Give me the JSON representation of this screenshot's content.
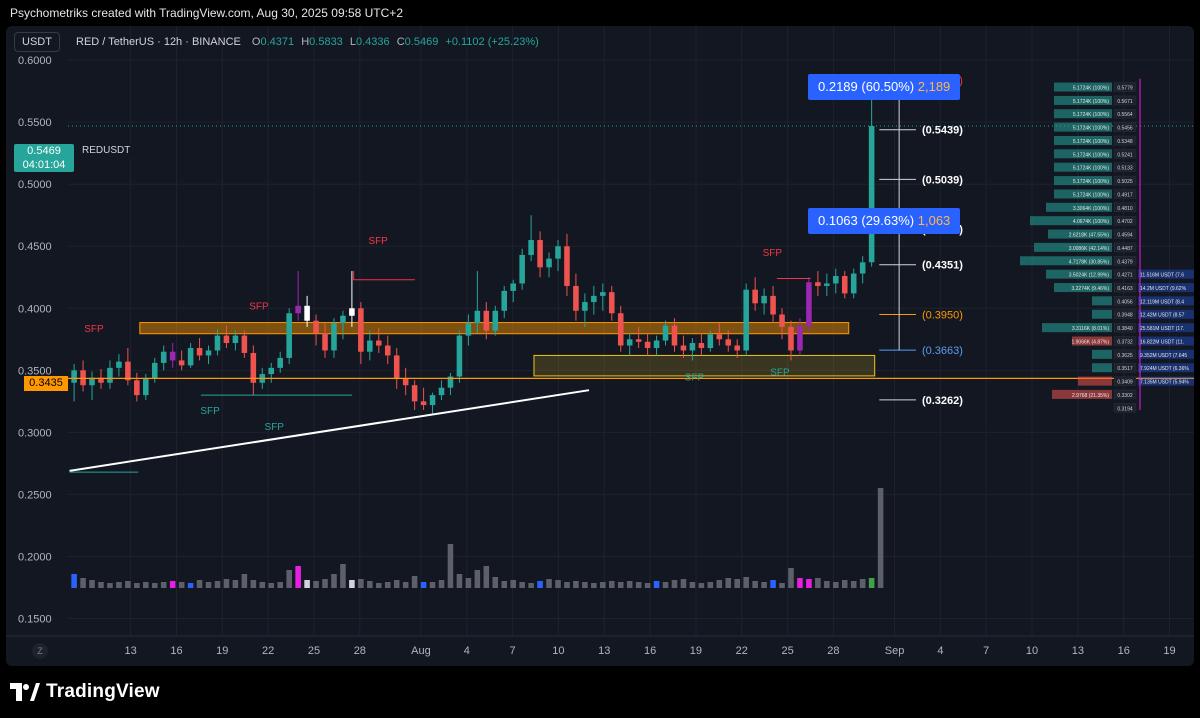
{
  "header": {
    "attribution": "Psychometriks created with TradingView.com, Aug 30, 2025 09:58 UTC+2"
  },
  "toolbar": {
    "symbol_button": "USDT",
    "pair": "RED / TetherUS · 12h · BINANCE",
    "open_label": "O",
    "open": "0.4371",
    "high_label": "H",
    "high": "0.5833",
    "low_label": "L",
    "low": "0.4336",
    "close_label": "C",
    "close": "0.5469",
    "change": "+0.1102 (+25.23%)"
  },
  "price_tag": {
    "value": "0.5469",
    "countdown": "04:01:04",
    "symbol": "REDUSDT"
  },
  "level_tag": "0.3435",
  "z_button": "Z",
  "measure_boxes": [
    {
      "name": "measure-top",
      "text_a": "0.2189 (60.50%)",
      "text_b": "2,189"
    },
    {
      "name": "measure-mid",
      "text_a": "0.1063 (29.63%)",
      "text_b": "1,063"
    }
  ],
  "footer": {
    "logo": "TradingView"
  },
  "colors": {
    "background": "#131722",
    "up": "#26a69a",
    "down": "#ef5350",
    "purple": "#9c27b0",
    "orange": "#ff9800",
    "yellow_zone": "#f0c419",
    "label_red": "#f23645",
    "label_blue": "#2962ff"
  },
  "chart_data": {
    "type": "candlestick",
    "symbol": "REDUSDT",
    "interval": "12h",
    "exchange": "BINANCE",
    "y_axis": {
      "ticks": [
        0.15,
        0.2,
        0.25,
        0.3,
        0.35,
        0.4,
        0.45,
        0.5,
        0.55,
        0.6
      ],
      "tick_labels": [
        "0.1500",
        "0.2000",
        "0.2500",
        "0.3000",
        "0.3500",
        "0.4000",
        "0.4500",
        "0.5000",
        "0.5500",
        "0.6000"
      ],
      "range": [
        0.1375,
        0.6275
      ]
    },
    "x_axis": {
      "ticks": [
        {
          "label": "13",
          "day": 13
        },
        {
          "label": "16",
          "day": 16
        },
        {
          "label": "19",
          "day": 19
        },
        {
          "label": "22",
          "day": 22
        },
        {
          "label": "25",
          "day": 25
        },
        {
          "label": "28",
          "day": 28
        },
        {
          "label": "Aug",
          "day": 32
        },
        {
          "label": "4",
          "day": 35
        },
        {
          "label": "7",
          "day": 38
        },
        {
          "label": "10",
          "day": 41
        },
        {
          "label": "13",
          "day": 44
        },
        {
          "label": "16",
          "day": 47
        },
        {
          "label": "19",
          "day": 50
        },
        {
          "label": "22",
          "day": 53
        },
        {
          "label": "25",
          "day": 56
        },
        {
          "label": "28",
          "day": 59
        },
        {
          "label": "Sep",
          "day": 63
        },
        {
          "label": "4",
          "day": 66
        },
        {
          "label": "7",
          "day": 69
        },
        {
          "label": "10",
          "day": 72
        },
        {
          "label": "13",
          "day": 75
        },
        {
          "label": "16",
          "day": 78
        },
        {
          "label": "19",
          "day": 81
        }
      ],
      "range": [
        8.9,
        82.6
      ]
    },
    "candles": [
      [
        0.34,
        0.355,
        0.325,
        0.35
      ],
      [
        0.35,
        0.358,
        0.333,
        0.338
      ],
      [
        0.338,
        0.349,
        0.326,
        0.344
      ],
      [
        0.344,
        0.351,
        0.335,
        0.34
      ],
      [
        0.34,
        0.358,
        0.335,
        0.352
      ],
      [
        0.352,
        0.363,
        0.345,
        0.357
      ],
      [
        0.357,
        0.368,
        0.338,
        0.342
      ],
      [
        0.342,
        0.348,
        0.325,
        0.33
      ],
      [
        0.33,
        0.347,
        0.326,
        0.343
      ],
      [
        0.343,
        0.36,
        0.34,
        0.356
      ],
      [
        0.356,
        0.37,
        0.35,
        0.365
      ],
      [
        0.365,
        0.372,
        0.352,
        0.358
      ],
      [
        0.358,
        0.366,
        0.35,
        0.354
      ],
      [
        0.354,
        0.372,
        0.352,
        0.368
      ],
      [
        0.368,
        0.376,
        0.358,
        0.362
      ],
      [
        0.362,
        0.37,
        0.355,
        0.366
      ],
      [
        0.366,
        0.383,
        0.362,
        0.378
      ],
      [
        0.378,
        0.386,
        0.368,
        0.372
      ],
      [
        0.372,
        0.382,
        0.366,
        0.378
      ],
      [
        0.378,
        0.382,
        0.36,
        0.364
      ],
      [
        0.364,
        0.37,
        0.33,
        0.34
      ],
      [
        0.34,
        0.352,
        0.335,
        0.347
      ],
      [
        0.347,
        0.356,
        0.34,
        0.352
      ],
      [
        0.352,
        0.365,
        0.348,
        0.36
      ],
      [
        0.36,
        0.4,
        0.355,
        0.396
      ],
      [
        0.396,
        0.43,
        0.39,
        0.402
      ],
      [
        0.402,
        0.41,
        0.385,
        0.39
      ],
      [
        0.39,
        0.395,
        0.37,
        0.38
      ],
      [
        0.38,
        0.388,
        0.36,
        0.366
      ],
      [
        0.366,
        0.392,
        0.36,
        0.388
      ],
      [
        0.388,
        0.398,
        0.375,
        0.394
      ],
      [
        0.394,
        0.43,
        0.385,
        0.4
      ],
      [
        0.4,
        0.405,
        0.355,
        0.365
      ],
      [
        0.365,
        0.382,
        0.358,
        0.374
      ],
      [
        0.374,
        0.384,
        0.364,
        0.37
      ],
      [
        0.37,
        0.378,
        0.355,
        0.362
      ],
      [
        0.362,
        0.368,
        0.335,
        0.343
      ],
      [
        0.343,
        0.352,
        0.33,
        0.338
      ],
      [
        0.338,
        0.342,
        0.318,
        0.325
      ],
      [
        0.325,
        0.336,
        0.318,
        0.322
      ],
      [
        0.322,
        0.332,
        0.315,
        0.33
      ],
      [
        0.33,
        0.342,
        0.326,
        0.336
      ],
      [
        0.336,
        0.348,
        0.33,
        0.345
      ],
      [
        0.345,
        0.382,
        0.34,
        0.378
      ],
      [
        0.378,
        0.395,
        0.37,
        0.388
      ],
      [
        0.388,
        0.43,
        0.38,
        0.398
      ],
      [
        0.398,
        0.405,
        0.375,
        0.382
      ],
      [
        0.382,
        0.402,
        0.378,
        0.398
      ],
      [
        0.398,
        0.418,
        0.392,
        0.414
      ],
      [
        0.414,
        0.423,
        0.405,
        0.42
      ],
      [
        0.42,
        0.448,
        0.415,
        0.443
      ],
      [
        0.443,
        0.475,
        0.438,
        0.455
      ],
      [
        0.455,
        0.462,
        0.425,
        0.433
      ],
      [
        0.433,
        0.445,
        0.425,
        0.44
      ],
      [
        0.44,
        0.455,
        0.43,
        0.45
      ],
      [
        0.45,
        0.46,
        0.41,
        0.418
      ],
      [
        0.418,
        0.428,
        0.39,
        0.398
      ],
      [
        0.398,
        0.412,
        0.385,
        0.405
      ],
      [
        0.405,
        0.418,
        0.395,
        0.41
      ],
      [
        0.41,
        0.42,
        0.398,
        0.413
      ],
      [
        0.413,
        0.418,
        0.39,
        0.396
      ],
      [
        0.396,
        0.402,
        0.365,
        0.37
      ],
      [
        0.37,
        0.38,
        0.362,
        0.375
      ],
      [
        0.375,
        0.385,
        0.368,
        0.373
      ],
      [
        0.373,
        0.38,
        0.362,
        0.368
      ],
      [
        0.368,
        0.378,
        0.362,
        0.374
      ],
      [
        0.374,
        0.39,
        0.37,
        0.386
      ],
      [
        0.386,
        0.392,
        0.365,
        0.37
      ],
      [
        0.37,
        0.378,
        0.36,
        0.366
      ],
      [
        0.366,
        0.376,
        0.358,
        0.372
      ],
      [
        0.372,
        0.38,
        0.362,
        0.368
      ],
      [
        0.368,
        0.382,
        0.365,
        0.379
      ],
      [
        0.379,
        0.388,
        0.37,
        0.375
      ],
      [
        0.375,
        0.382,
        0.365,
        0.37
      ],
      [
        0.37,
        0.375,
        0.36,
        0.366
      ],
      [
        0.366,
        0.42,
        0.362,
        0.415
      ],
      [
        0.415,
        0.425,
        0.398,
        0.404
      ],
      [
        0.404,
        0.416,
        0.395,
        0.41
      ],
      [
        0.41,
        0.418,
        0.388,
        0.395
      ],
      [
        0.395,
        0.4,
        0.375,
        0.385
      ],
      [
        0.385,
        0.39,
        0.358,
        0.366
      ],
      [
        0.366,
        0.392,
        0.362,
        0.386
      ],
      [
        0.386,
        0.425,
        0.38,
        0.421
      ],
      [
        0.421,
        0.43,
        0.41,
        0.418
      ],
      [
        0.418,
        0.428,
        0.41,
        0.42
      ],
      [
        0.42,
        0.432,
        0.412,
        0.426
      ],
      [
        0.426,
        0.43,
        0.408,
        0.412
      ],
      [
        0.412,
        0.432,
        0.408,
        0.428
      ],
      [
        0.428,
        0.442,
        0.42,
        0.437
      ],
      [
        0.4371,
        0.5833,
        0.4336,
        0.5469
      ]
    ],
    "candle_colors": {
      "26": "white",
      "31": "white",
      "25": "purple",
      "82": "purple",
      "81": "purple",
      "11": "purple"
    },
    "volume": {
      "ylim": [
        0,
        100
      ],
      "values": [
        14,
        10,
        8,
        6,
        5,
        6,
        7,
        5,
        6,
        5,
        6,
        7,
        6,
        5,
        8,
        6,
        7,
        9,
        8,
        14,
        8,
        6,
        5,
        6,
        18,
        22,
        8,
        7,
        9,
        14,
        24,
        8,
        9,
        7,
        5,
        6,
        8,
        6,
        12,
        6,
        6,
        8,
        44,
        14,
        10,
        18,
        22,
        11,
        7,
        8,
        6,
        5,
        7,
        9,
        8,
        6,
        7,
        6,
        5,
        6,
        7,
        6,
        7,
        6,
        5,
        7,
        6,
        8,
        9,
        6,
        5,
        6,
        8,
        10,
        9,
        11,
        7,
        6,
        8,
        5,
        20,
        10,
        9,
        10,
        7,
        6,
        8,
        7,
        9,
        10,
        100
      ]
    },
    "annotations": {
      "price_labels": [
        {
          "text": "(0.5839)",
          "price": 0.5839,
          "color": "#f23645"
        },
        {
          "text": "(0.5439)",
          "price": 0.5439,
          "color": "#ffffff"
        },
        {
          "text": "(0.5039)",
          "price": 0.5039,
          "color": "#ffffff"
        },
        {
          "text": "(0.4638)",
          "price": 0.4638,
          "color": "#ffffff"
        },
        {
          "text": "(0.4351)",
          "price": 0.4351,
          "color": "#ffffff"
        },
        {
          "text": "(0.3950)",
          "price": 0.395,
          "color": "#ff9800"
        },
        {
          "text": "(0.3663)",
          "price": 0.3663,
          "color": "#5b9cf6"
        },
        {
          "text": "(0.3262)",
          "price": 0.3262,
          "color": "#ffffff"
        }
      ],
      "sfp_labels": [
        {
          "text": "SFP",
          "day": 10.6,
          "price": 0.381,
          "color": "#f23645"
        },
        {
          "text": "SFP",
          "day": 21.4,
          "price": 0.399,
          "color": "#f23645"
        },
        {
          "text": "SFP",
          "day": 29.2,
          "price": 0.452,
          "color": "#f23645"
        },
        {
          "text": "SFP",
          "day": 55.0,
          "price": 0.442,
          "color": "#f23645"
        },
        {
          "text": "SFP",
          "day": 18.2,
          "price": 0.315,
          "color": "#26a69a"
        },
        {
          "text": "SFP",
          "day": 22.4,
          "price": 0.302,
          "color": "#26a69a"
        },
        {
          "text": "SFP",
          "day": 49.9,
          "price": 0.342,
          "color": "#26a69a"
        },
        {
          "text": "SFP",
          "day": 55.5,
          "price": 0.346,
          "color": "#26a69a"
        }
      ],
      "orange_level": 0.3435,
      "last_price": 0.5469
    },
    "order_book": {
      "rows": [
        {
          "price_label": "0.5779",
          "size_label": "5.1724K (100%)",
          "width": 58,
          "color": "teal"
        },
        {
          "price_label": "0.5671",
          "size_label": "5.1724K (100%)",
          "width": 58,
          "color": "teal"
        },
        {
          "price_label": "0.5564",
          "size_label": "5.1724K (100%)",
          "width": 58,
          "color": "teal"
        },
        {
          "price_label": "0.5456",
          "size_label": "5.1724K (100%)",
          "width": 58,
          "color": "teal"
        },
        {
          "price_label": "0.5348",
          "size_label": "5.1724K (100%)",
          "width": 58,
          "color": "teal"
        },
        {
          "price_label": "0.5241",
          "size_label": "5.1724K (100%)",
          "width": 58,
          "color": "teal"
        },
        {
          "price_label": "0.5133",
          "size_label": "5.1724K (100%)",
          "width": 58,
          "color": "teal"
        },
        {
          "price_label": "0.5025",
          "size_label": "5.1724K (100%)",
          "width": 58,
          "color": "teal"
        },
        {
          "price_label": "0.4917",
          "size_label": "5.1724K (100%)",
          "width": 58,
          "color": "teal"
        },
        {
          "price_label": "0.4810",
          "size_label": "3.3064K (100%)",
          "width": 66,
          "color": "teal"
        },
        {
          "price_label": "0.4702",
          "size_label": "4.0674K (100%)",
          "width": 82,
          "color": "teal"
        },
        {
          "price_label": "0.4594",
          "size_label": "2.6218K (47.55%)",
          "width": 64,
          "color": "teal"
        },
        {
          "price_label": "0.4487",
          "size_label": "3.0086K (42.14%)",
          "width": 78,
          "color": "teal"
        },
        {
          "price_label": "0.4379",
          "size_label": "4.7178K (30.85%)",
          "width": 92,
          "color": "teal"
        },
        {
          "price_label": "0.4271",
          "size_label": "3.5024K (12.99%)",
          "width": 66,
          "color": "teal"
        },
        {
          "price_label": "0.4163",
          "size_label": "3.2274K (9.46%)",
          "width": 58,
          "color": "teal"
        },
        {
          "price_label": "0.4056",
          "size_label": "",
          "width": 20,
          "color": "teal"
        },
        {
          "price_label": "0.3948",
          "size_label": "",
          "width": 20,
          "color": "teal"
        },
        {
          "price_label": "0.3840",
          "size_label": "3.3116K (8.01%)",
          "width": 70,
          "color": "teal"
        },
        {
          "price_label": "0.3732",
          "size_label": "1.9066K (4.87%)",
          "width": 40,
          "color": "red"
        },
        {
          "price_label": "0.3625",
          "size_label": "",
          "width": 20,
          "color": "teal"
        },
        {
          "price_label": "0.3517",
          "size_label": "",
          "width": 20,
          "color": "teal"
        },
        {
          "price_label": "0.3409",
          "size_label": "",
          "width": 34,
          "color": "red"
        },
        {
          "price_label": "0.3302",
          "size_label": "2.9768 (21.35%)",
          "width": 60,
          "color": "red"
        },
        {
          "price_label": "0.3194",
          "size_label": "",
          "width": 0,
          "color": "red"
        }
      ],
      "right_labels": [
        {
          "price": 0.4271,
          "text": "11.516M USDT (7.6"
        },
        {
          "price": 0.4163,
          "text": "14.2M USDT (9.62%"
        },
        {
          "price": 0.4056,
          "text": "12.119M USDT (8.4"
        },
        {
          "price": 0.3948,
          "text": "12.42M USDT (8.57"
        },
        {
          "price": 0.384,
          "text": "25.581M USDT (17."
        },
        {
          "price": 0.3732,
          "text": "16.822M USDT (11."
        },
        {
          "price": 0.3625,
          "text": "9.352M USDT (7.645"
        },
        {
          "price": 0.3517,
          "text": "7.924M USDT (6.36%"
        },
        {
          "price": 0.3409,
          "text": "7.135M USDT (5.94%"
        }
      ]
    }
  }
}
